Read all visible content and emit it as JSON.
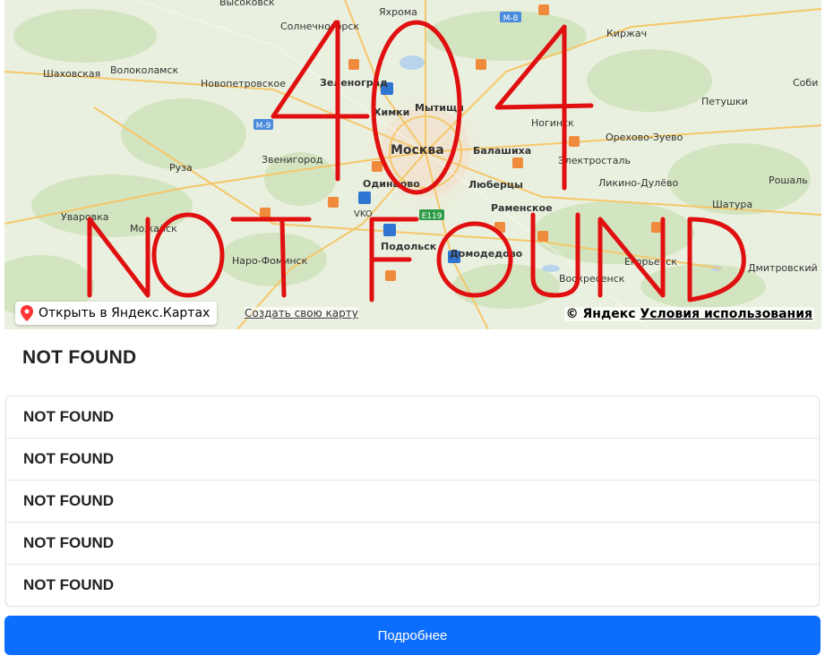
{
  "map": {
    "places": [
      {
        "name": "Высоковск",
        "bold": false
      },
      {
        "name": "Яхрома",
        "bold": false
      },
      {
        "name": "Солнечногорск",
        "bold": false
      },
      {
        "name": "Киржач",
        "bold": false
      },
      {
        "name": "Шаховская",
        "bold": false
      },
      {
        "name": "Волоколамск",
        "bold": false
      },
      {
        "name": "Новопетровское",
        "bold": false
      },
      {
        "name": "Зеленоград",
        "bold": true
      },
      {
        "name": "Соби",
        "bold": false
      },
      {
        "name": "Петушки",
        "bold": false
      },
      {
        "name": "Химки",
        "bold": true
      },
      {
        "name": "Мытищи",
        "bold": true
      },
      {
        "name": "Ногинск",
        "bold": false
      },
      {
        "name": "Орехово-Зуево",
        "bold": false
      },
      {
        "name": "Москва",
        "bold": true
      },
      {
        "name": "Балашиха",
        "bold": true
      },
      {
        "name": "Звенигород",
        "bold": false
      },
      {
        "name": "Электросталь",
        "bold": false
      },
      {
        "name": "Руза",
        "bold": false
      },
      {
        "name": "Одинцово",
        "bold": true
      },
      {
        "name": "Люберцы",
        "bold": true
      },
      {
        "name": "Ликино-Дулёво",
        "bold": false
      },
      {
        "name": "Рошаль",
        "bold": false
      },
      {
        "name": "Раменское",
        "bold": true
      },
      {
        "name": "Шатура",
        "bold": false
      },
      {
        "name": "Уваровка",
        "bold": false
      },
      {
        "name": "Можайск",
        "bold": false
      },
      {
        "name": "VKO",
        "bold": false
      },
      {
        "name": "Подольск",
        "bold": true
      },
      {
        "name": "Домодедово",
        "bold": true
      },
      {
        "name": "Наро-Фоминск",
        "bold": false
      },
      {
        "name": "Егорьевск",
        "bold": false
      },
      {
        "name": "Воскресенск",
        "bold": false
      },
      {
        "name": "Дмитровский Погост",
        "bold": false
      }
    ],
    "road_badges": {
      "m8": "M-8",
      "m9": "M-9",
      "e119": "E119"
    },
    "open_in_yandex_label": "Открыть в Яндекс.Картах",
    "create_map_label": "Создать свою карту",
    "copyright_label": "© Яндекс",
    "terms_label": "Условия использования",
    "overlay_text": [
      "404",
      "NOT FOUND"
    ],
    "overlay_color": "#e01010"
  },
  "card": {
    "title": "NOT FOUND",
    "items": [
      {
        "label": "NOT FOUND"
      },
      {
        "label": "NOT FOUND"
      },
      {
        "label": "NOT FOUND"
      },
      {
        "label": "NOT FOUND"
      },
      {
        "label": "NOT FOUND"
      }
    ],
    "more_button_label": "Подробнее",
    "button_color": "#0d6efd"
  }
}
